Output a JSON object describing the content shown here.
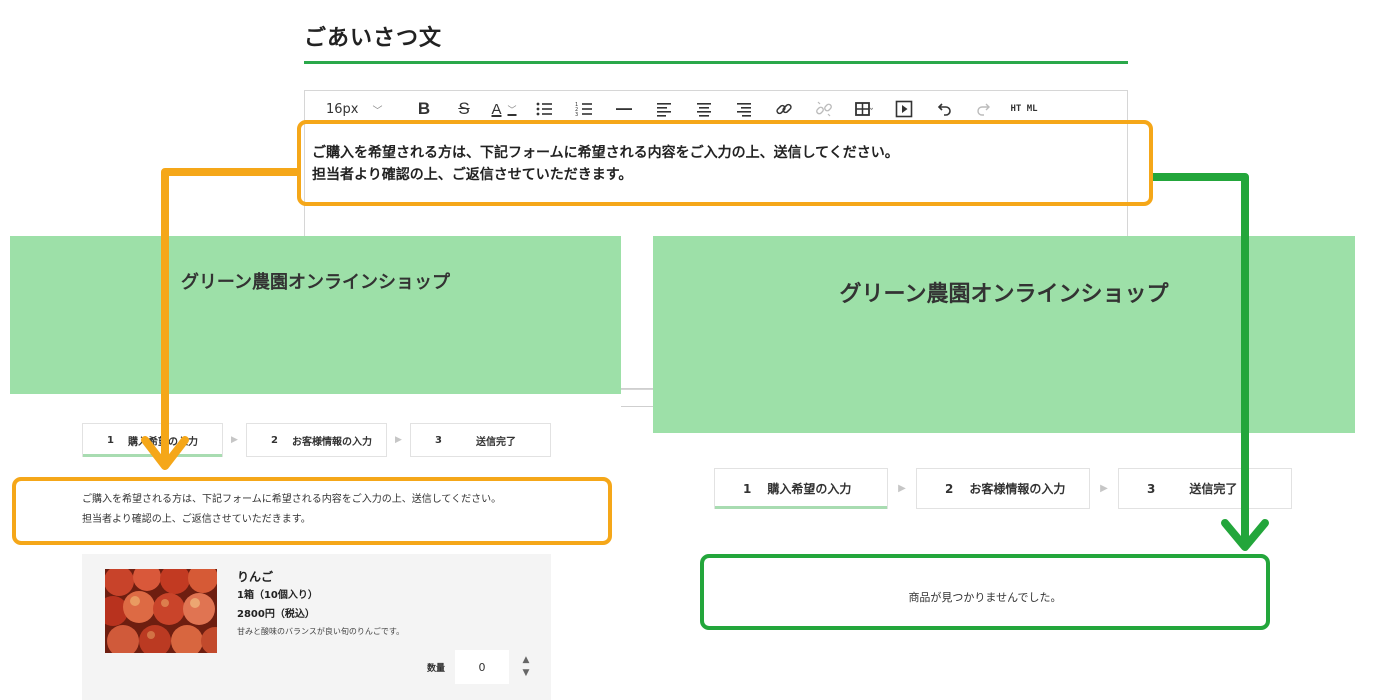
{
  "editor": {
    "title": "ごあいさつ文",
    "toolbar": {
      "font_size": "16px",
      "bold": "B",
      "strike": "S",
      "font_color": "A",
      "html": "HT ML"
    },
    "content_lines": [
      "ご購入を希望される方は、下記フォームに希望される内容をご入力の上、送信してください。",
      "担当者より確認の上、ご返信させていただきます。"
    ]
  },
  "left_preview": {
    "shop_name": "グリーン農園オンラインショップ",
    "steps": [
      {
        "num": "1",
        "label": "購入希望の入力"
      },
      {
        "num": "2",
        "label": "お客様情報の入力"
      },
      {
        "num": "3",
        "label": "送信完了"
      }
    ],
    "greeting_lines": [
      "ご購入を希望される方は、下記フォームに希望される内容をご入力の上、送信してください。",
      "担当者より確認の上、ご返信させていただきます。"
    ],
    "product": {
      "name": "りんご",
      "quantity_unit": "1箱（10個入り）",
      "price": "2800円（税込）",
      "description": "甘みと酸味のバランスが良い旬のりんごです。",
      "qty_label": "数量",
      "qty_value": "0"
    }
  },
  "right_preview": {
    "shop_name": "グリーン農園オンラインショップ",
    "steps": [
      {
        "num": "1",
        "label": "購入希望の入力"
      },
      {
        "num": "2",
        "label": "お客様情報の入力"
      },
      {
        "num": "3",
        "label": "送信完了"
      }
    ],
    "not_found": "商品が見つかりませんでした。"
  },
  "colors": {
    "accent_green": "#2aa84a",
    "header_green": "#9de0a8",
    "callout_orange": "#f5a719",
    "callout_green": "#23a63b"
  },
  "icons": [
    "chevron-down-icon",
    "bullet-list-icon",
    "numbered-list-icon",
    "horizontal-rule-icon",
    "align-left-icon",
    "align-center-icon",
    "align-right-icon",
    "link-icon",
    "unlink-icon",
    "table-icon",
    "media-icon",
    "undo-icon",
    "redo-icon"
  ]
}
